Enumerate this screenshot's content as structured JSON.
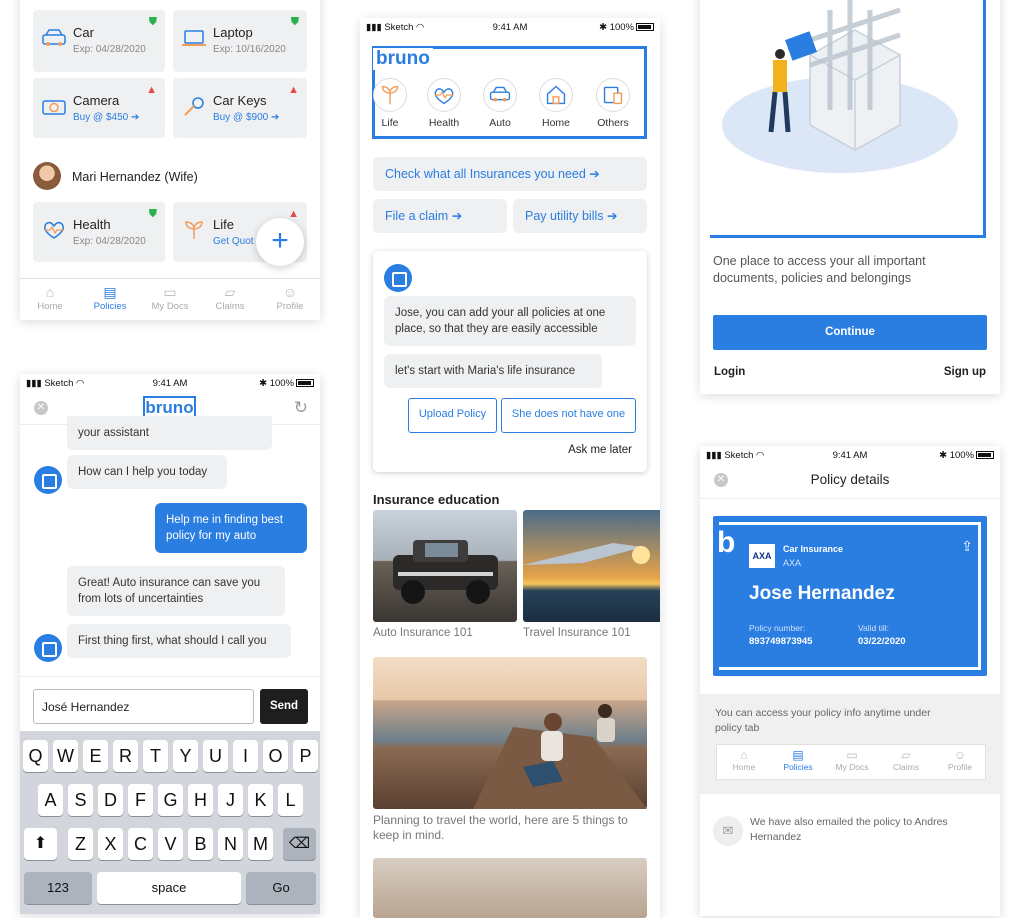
{
  "s1": {
    "tiles": [
      {
        "title": "Car",
        "sub": "Exp: 04/28/2020",
        "badge": "ok"
      },
      {
        "title": "Laptop",
        "sub": "Exp: 10/16/2020",
        "badge": "ok"
      },
      {
        "title": "Camera",
        "sub": "Buy @ $450 ➔",
        "badge": "warn"
      },
      {
        "title": "Car Keys",
        "sub": "Buy @ $900 ➔",
        "badge": "warn"
      }
    ],
    "member": "Mari Hernandez (Wife)",
    "tiles2": [
      {
        "title": "Health",
        "sub": "Exp: 04/28/2020",
        "badge": "ok"
      },
      {
        "title": "Life",
        "sub": "Get Quot",
        "badge": "warn"
      }
    ],
    "fab": "+",
    "tabs": [
      "Home",
      "Policies",
      "My Docs",
      "Claims",
      "Profile"
    ]
  },
  "status": {
    "carrier": "Sketch",
    "time": "9:41 AM",
    "battery": "100%"
  },
  "chat": {
    "logo": "bruno",
    "messages": [
      {
        "text": "your assistant",
        "from": "bot"
      },
      {
        "text": "How can I help you today",
        "from": "bot"
      },
      {
        "text": "Help me in finding best policy for my auto",
        "from": "me"
      },
      {
        "text": "Great! Auto insurance can save you from lots of uncertainties",
        "from": "bot"
      },
      {
        "text": "First thing first, what should I call you",
        "from": "bot"
      }
    ],
    "input": "José Hernandez",
    "send": "Send",
    "keys_row1": [
      "Q",
      "W",
      "E",
      "R",
      "T",
      "Y",
      "U",
      "I",
      "O",
      "P"
    ],
    "keys_row2": [
      "A",
      "S",
      "D",
      "F",
      "G",
      "H",
      "J",
      "K",
      "L"
    ],
    "keys_row3": [
      "Z",
      "X",
      "C",
      "V",
      "B",
      "N",
      "M"
    ],
    "key_123": "123",
    "key_space": "space",
    "key_go": "Go"
  },
  "home": {
    "logo": "bruno",
    "categories": [
      "Life",
      "Health",
      "Auto",
      "Home",
      "Others"
    ],
    "check": "Check what all Insurances you need",
    "claim": "File a claim",
    "bills": "Pay utility bills",
    "card_msg1": "Jose, you can add your all policies at one place, so that they are easily accessible",
    "card_msg2": "let's start with Maria's life insurance",
    "upload": "Upload Policy",
    "no_one": "She does not have one",
    "later": "Ask me later",
    "edu_title": "Insurance education",
    "edu1": "Auto Insurance 101",
    "edu2": "Travel Insurance 101",
    "article": "Planning to travel the world, here are 5 things to keep in mind."
  },
  "onboard": {
    "text": "One place to access your all important documents, policies and belongings",
    "continue": "Continue",
    "login": "Login",
    "signup": "Sign up"
  },
  "policy": {
    "title": "Policy details",
    "type": "Car Insurance",
    "insurer": "AXA",
    "insurer_logo": "AXA",
    "name": "Jose Hernandez",
    "num_label": "Policy number:",
    "num": "893749873945",
    "valid_label": "Valid till:",
    "valid": "03/22/2020",
    "info": "You can access your policy info anytime under policy tab",
    "tabs": [
      "Home",
      "Policies",
      "My Docs",
      "Claims",
      "Profile"
    ],
    "email": "We have also emailed the policy to Andres Hernandez"
  }
}
